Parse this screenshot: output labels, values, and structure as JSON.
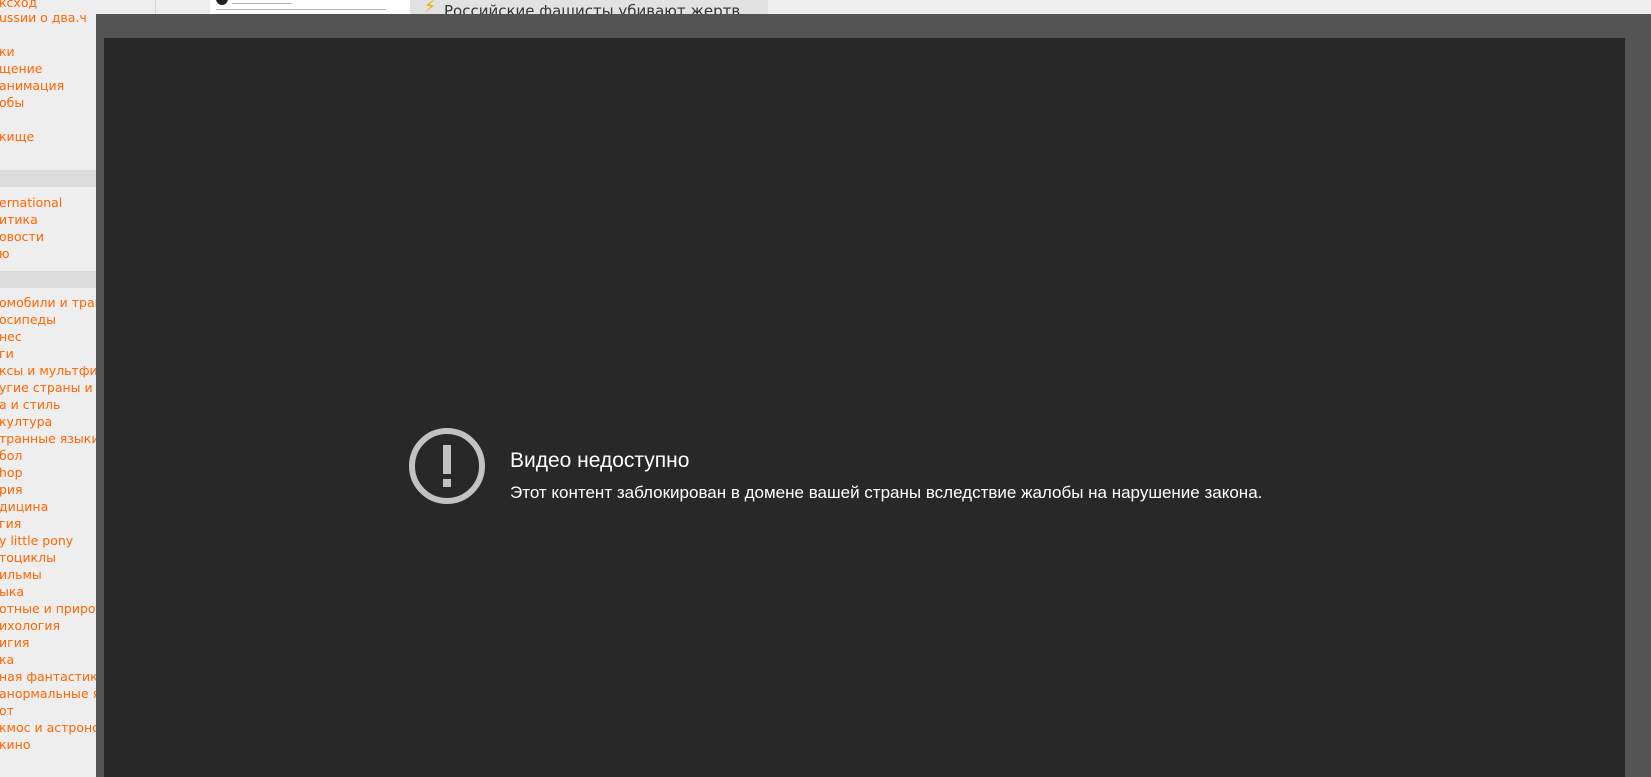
{
  "left_nav": {
    "group_1": [
      "ксход",
      "ussии о два.ч",
      "ки",
      "щение",
      "анимация",
      "обы",
      "кище"
    ],
    "group_2": [
      "ernational",
      "итика",
      "овости",
      "ю"
    ],
    "group_3": [
      "омобили и транс",
      "осипеды",
      "нес",
      "ги",
      "ксы и мультфил",
      "угие страны и ту",
      "а и стиль",
      "културa",
      "транные языки",
      "бол",
      "hop",
      "рия",
      "дицина",
      "гия",
      "y little pony",
      "тоциклы",
      "ильмы",
      "ыка",
      "отные и природ",
      "ихология",
      "игия",
      "ка",
      "ная фантастика",
      "анормальные яв",
      "от",
      "кмос и астроном",
      "кино"
    ]
  },
  "news_strip": {
    "bolt_icon": "lightning-icon",
    "headline": "Российские фашисты убивают жертв"
  },
  "player": {
    "error_icon": "alert-circle-icon",
    "error_title": "Видео недоступно",
    "error_message": "Этот контент заблокирован в домене вашей страны вследствие жалобы на нарушение закона."
  },
  "colors": {
    "page_bg": "#eeeeee",
    "nav_link": "#ff6600",
    "frame": "#545454",
    "player_bg": "#282828",
    "icon": "#c2c2c2",
    "text": "#ffffff"
  }
}
